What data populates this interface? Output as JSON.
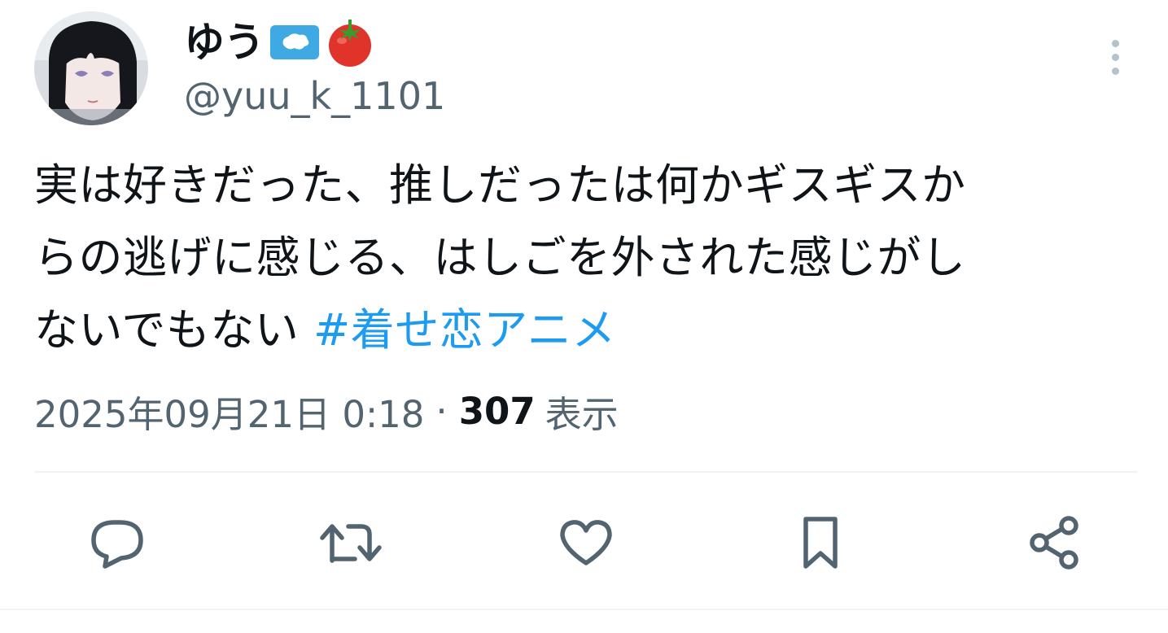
{
  "author": {
    "display_name": "ゆう",
    "handle": "@yuu_k_1101",
    "badges": [
      "antarctica-flag-icon",
      "tomato-icon"
    ]
  },
  "tweet": {
    "text_lines": [
      "実は好きだった、推しだったは何かギスギスか",
      "らの逃げに感じる、はしごを外された感じがし",
      "ないでもない "
    ],
    "hashtag": "#着せ恋アニメ",
    "timestamp": "2025年09月21日 0:18",
    "separator": "·",
    "views_count": "307",
    "views_label": "表示"
  },
  "actions": [
    "reply-icon",
    "retweet-icon",
    "like-icon",
    "bookmark-icon",
    "share-icon"
  ],
  "colors": {
    "text": "#0f1419",
    "secondary": "#536471",
    "link": "#1d9bf0",
    "divider": "#eff3f4"
  }
}
